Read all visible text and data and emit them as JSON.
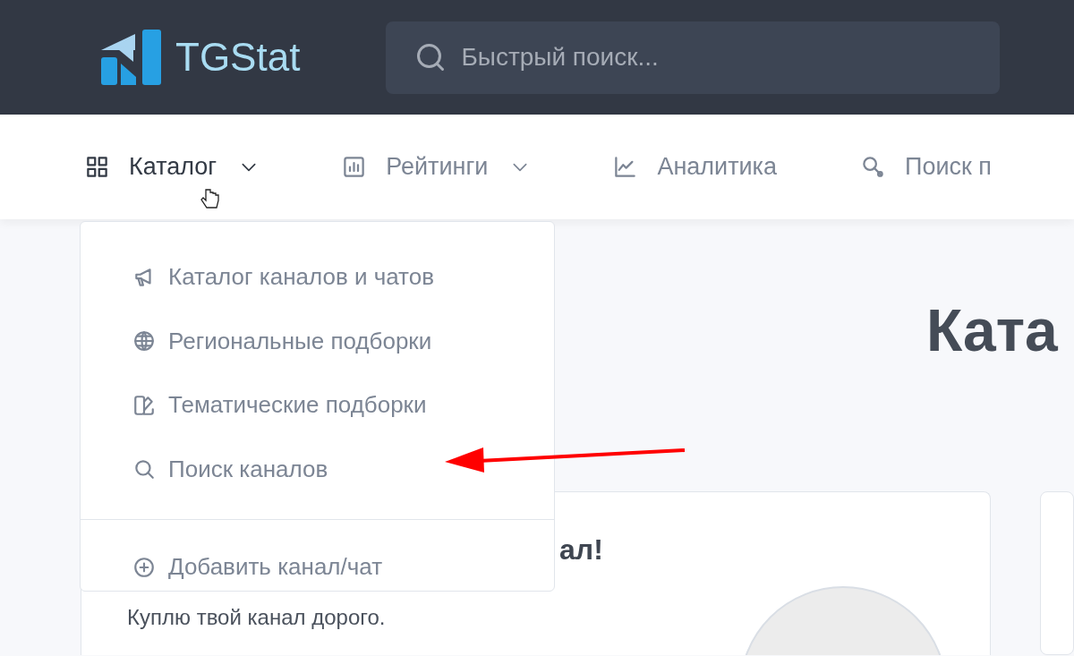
{
  "logo": {
    "text": "TGStat"
  },
  "search": {
    "placeholder": "Быстрый поиск..."
  },
  "nav": [
    {
      "label": "Каталог",
      "kind": "grid",
      "has_menu": true,
      "selected": true
    },
    {
      "label": "Рейтинги",
      "kind": "bars",
      "has_menu": true,
      "selected": false
    },
    {
      "label": "Аналитика",
      "kind": "chart",
      "has_menu": false,
      "selected": false
    },
    {
      "label": "Поиск п",
      "kind": "key",
      "has_menu": false,
      "selected": false
    }
  ],
  "dropdown": {
    "items": [
      {
        "label": "Каталог каналов и чатов",
        "kind": "megaphone"
      },
      {
        "label": "Региональные подборки",
        "kind": "globe"
      },
      {
        "label": "Тематические подборки",
        "kind": "swatch"
      },
      {
        "label": "Поиск каналов",
        "kind": "search"
      }
    ],
    "footer_item": {
      "label": "Добавить канал/чат",
      "kind": "plus"
    }
  },
  "page": {
    "heading": "Ката",
    "card": {
      "title": "ал!",
      "text": "Куплю твой канал дорого."
    }
  }
}
